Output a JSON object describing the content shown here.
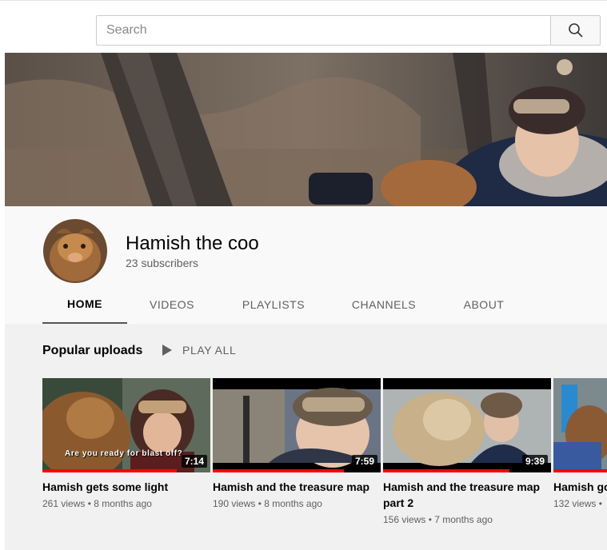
{
  "search": {
    "placeholder": "Search"
  },
  "channel": {
    "name": "Hamish the coo",
    "subscribers": "23 subscribers"
  },
  "tabs": [
    {
      "label": "HOME",
      "active": true
    },
    {
      "label": "VIDEOS",
      "active": false
    },
    {
      "label": "PLAYLISTS",
      "active": false
    },
    {
      "label": "CHANNELS",
      "active": false
    },
    {
      "label": "ABOUT",
      "active": false
    }
  ],
  "shelf": {
    "title": "Popular uploads",
    "play_all": "PLAY ALL"
  },
  "videos": [
    {
      "title": "Hamish gets some light",
      "meta": "261 views • 8 months ago",
      "duration": "7:14",
      "overlay": "Are you ready for blast off?",
      "watched": 0.8
    },
    {
      "title": "Hamish and the treasure map",
      "meta": "190 views • 8 months ago",
      "duration": "7:59",
      "watched": 0.78
    },
    {
      "title": "Hamish and the treasure map part 2",
      "meta": "156 views • 7 months ago",
      "duration": "9:39",
      "watched": 0.75
    },
    {
      "title": "Hamish go",
      "meta": "132 views •",
      "duration": "",
      "watched": 1.0
    }
  ],
  "colors": {
    "accent_red": "#ff0000",
    "header_bg": "#f9f9f9",
    "content_bg": "#f1f1f1"
  },
  "icons": {
    "search": "search-icon",
    "play": "play-icon"
  }
}
